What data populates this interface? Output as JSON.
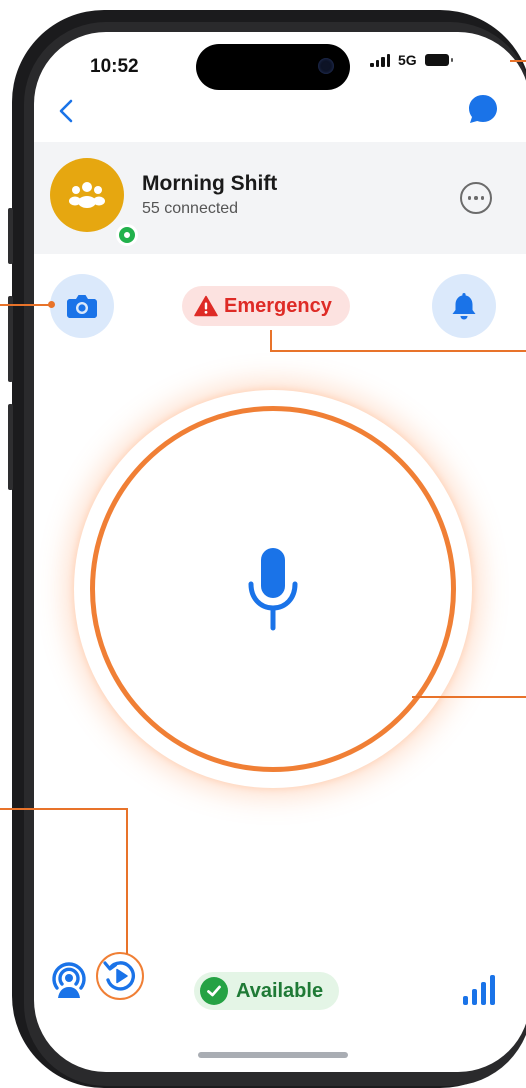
{
  "status_bar": {
    "time": "10:52",
    "network": "5G"
  },
  "nav": {
    "back_icon": "chevron-left-icon",
    "chat_icon": "chat-bubble-icon"
  },
  "group": {
    "name": "Morning Shift",
    "connected": "55 connected",
    "avatar_icon": "group-people-icon",
    "more_icon": "ellipsis-icon"
  },
  "controls": {
    "camera_icon": "camera-icon",
    "alert_icon": "bell-icon",
    "emergency_label": "Emergency",
    "emergency_icon": "warning-triangle-icon"
  },
  "ptt": {
    "mic_icon": "microphone-icon"
  },
  "bottom_bar": {
    "broadcast_icon": "broadcast-icon",
    "history_icon": "replay-icon",
    "status_label": "Available",
    "signal_icon": "signal-bars-icon"
  },
  "colors": {
    "accent_blue": "#1a73e8",
    "callout_orange": "#e8732a",
    "emergency_red": "#de2b26",
    "available_green": "#25a244",
    "avatar_gold": "#e6a710"
  }
}
